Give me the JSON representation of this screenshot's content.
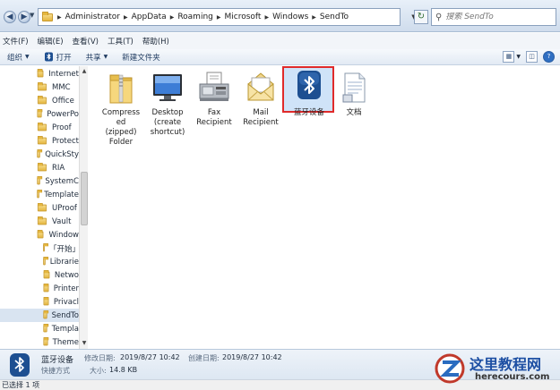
{
  "address": {
    "crumbs": [
      "Administrator",
      "AppData",
      "Roaming",
      "Microsoft",
      "Windows",
      "SendTo"
    ]
  },
  "search": {
    "placeholder": "搜索 SendTo"
  },
  "menu": [
    "文件(F)",
    "编辑(E)",
    "查看(V)",
    "工具(T)",
    "帮助(H)"
  ],
  "toolbar": {
    "organize": "组织",
    "open": "打开",
    "share": "共享",
    "new_folder": "新建文件夹"
  },
  "nav": {
    "items": [
      {
        "label": "Internet",
        "indent": 0
      },
      {
        "label": "MMC",
        "indent": 0
      },
      {
        "label": "Office",
        "indent": 0
      },
      {
        "label": "PowerPo",
        "indent": 0
      },
      {
        "label": "Proof",
        "indent": 0
      },
      {
        "label": "Protect",
        "indent": 0
      },
      {
        "label": "QuickSty",
        "indent": 0
      },
      {
        "label": "RIA",
        "indent": 0
      },
      {
        "label": "SystemC",
        "indent": 0
      },
      {
        "label": "Template",
        "indent": 0
      },
      {
        "label": "UProof",
        "indent": 0
      },
      {
        "label": "Vault",
        "indent": 0
      },
      {
        "label": "Window",
        "indent": 0
      },
      {
        "label": "「开始」",
        "indent": 1
      },
      {
        "label": "Librarie",
        "indent": 1
      },
      {
        "label": "Netwo",
        "indent": 1
      },
      {
        "label": "Printer",
        "indent": 1
      },
      {
        "label": "Privacl",
        "indent": 1
      },
      {
        "label": "SendTo",
        "indent": 1,
        "selected": true
      },
      {
        "label": "Templa",
        "indent": 1
      },
      {
        "label": "Theme",
        "indent": 1
      }
    ]
  },
  "files": [
    {
      "name": "Compressed (zipped) Folder",
      "lines": [
        "Compress",
        "ed",
        "(zipped)",
        "Folder"
      ],
      "icon": "zip-folder-icon"
    },
    {
      "name": "Desktop (create shortcut)",
      "lines": [
        "Desktop",
        "(create",
        "shortcut)"
      ],
      "icon": "desktop-icon"
    },
    {
      "name": "Fax Recipient",
      "lines": [
        "Fax",
        "Recipient"
      ],
      "icon": "fax-icon"
    },
    {
      "name": "Mail Recipient",
      "lines": [
        "Mail",
        "Recipient"
      ],
      "icon": "mail-icon"
    },
    {
      "name": "蓝牙设备",
      "lines": [
        "蓝牙设备"
      ],
      "icon": "bluetooth-icon",
      "selected": true
    },
    {
      "name": "文档",
      "lines": [
        "文档"
      ],
      "icon": "document-icon"
    }
  ],
  "details": {
    "name": "蓝牙设备",
    "type": "快捷方式",
    "modified_label": "修改日期:",
    "modified": "2019/8/27 10:42",
    "created_label": "创建日期:",
    "created": "2019/8/27 10:42",
    "size_label": "大小:",
    "size": "14.8 KB"
  },
  "status": "已选择 1 项",
  "watermark": {
    "brand": "这里教程网",
    "url": "herecours.com"
  },
  "colors": {
    "selection_border": "#e02a2a",
    "selection_fill": "#cfe3f8",
    "bluetooth": "#1d4f91"
  }
}
